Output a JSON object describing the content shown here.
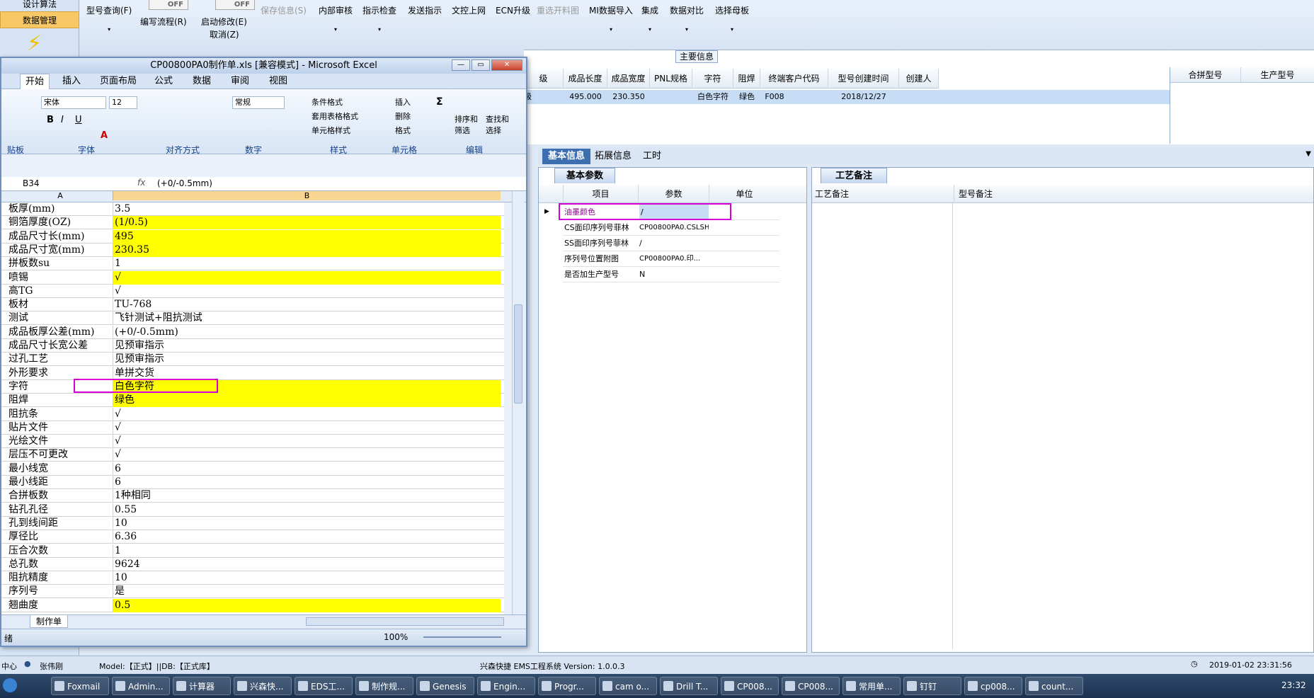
{
  "app": {
    "nav": [
      "设计算法",
      "数据管理"
    ],
    "toggles": [
      "OFF",
      "OFF"
    ],
    "ribbon": [
      "型号查询(F)",
      "编写流程(R)",
      "启动修改(E)",
      "取消(Z)",
      "保存信息(S)",
      "内部审核",
      "指示检查",
      "发送指示",
      "文控上网",
      "ECN升级",
      "重选开料图",
      "MI数据导入",
      "集成",
      "数据对比",
      "选择母板"
    ],
    "main_info_title": "主要信息",
    "grid_headers": [
      "级",
      "成品长度",
      "成品宽度",
      "PNL规格",
      "字符",
      "阻焊",
      "终端客户代码",
      "型号创建时间",
      "创建人"
    ],
    "grid_row": [
      "级",
      "495.000",
      "230.350",
      "",
      "白色字符",
      "绿色",
      "F008",
      "2018/12/27",
      ""
    ],
    "side_headers": [
      "合拼型号",
      "生产型号"
    ],
    "detail_tabs": [
      "基本信息",
      "拓展信息",
      "工时"
    ],
    "param_tab": "基本参数",
    "param_headers": [
      "项目",
      "参数",
      "单位"
    ],
    "param_rows": [
      {
        "item": "油墨颜色",
        "value": "/",
        "unit": ""
      },
      {
        "item": "CS面印序列号菲林",
        "value": "CP00800PA0.CSLSH",
        "unit": ""
      },
      {
        "item": "SS面印序列号菲林",
        "value": "/",
        "unit": ""
      },
      {
        "item": "序列号位置附图",
        "value": "CP00800PA0.印...",
        "unit": ""
      },
      {
        "item": "是否加生产型号",
        "value": "N",
        "unit": ""
      }
    ],
    "remark_tab": "工艺备注",
    "remark_headers": [
      "工艺备注",
      "型号备注"
    ],
    "status": {
      "center": "中心",
      "user": "张伟刚",
      "model": "Model:【正式】||DB:【正式库】",
      "system": "兴森快捷 EMS工程系统 Version: 1.0.0.3",
      "datetime": "2019-01-02 23:31:56"
    }
  },
  "excel": {
    "title": "CP00800PA0制作单.xls [兼容模式] - Microsoft Excel",
    "tabs": [
      "开始",
      "插入",
      "页面布局",
      "公式",
      "数据",
      "审阅",
      "视图"
    ],
    "font_name": "宋体",
    "font_size": "12",
    "number_format": "常规",
    "ribbon_small": [
      "条件格式",
      "套用表格格式",
      "单元格样式",
      "插入",
      "删除",
      "格式",
      "排序和",
      "筛选",
      "查找和",
      "选择"
    ],
    "groups": [
      "贴板",
      "字体",
      "对齐方式",
      "数字",
      "样式",
      "单元格",
      "编辑"
    ],
    "name_box": "B34",
    "fx": "fx",
    "formula": "(+0/-0.5mm)",
    "col_a": "A",
    "col_b": "B",
    "rows": [
      {
        "a": "板厚(mm)",
        "b": "3.5",
        "yellow": false
      },
      {
        "a": "铜箔厚度(OZ)",
        "b": "(1/0.5)",
        "yellow": true
      },
      {
        "a": "成品尺寸长(mm)",
        "b": "495",
        "yellow": true
      },
      {
        "a": "成品尺寸宽(mm)",
        "b": "230.35",
        "yellow": true
      },
      {
        "a": "拼板数su",
        "b": "1",
        "yellow": false
      },
      {
        "a": "喷锡",
        "b": "√",
        "yellow": true
      },
      {
        "a": "高TG",
        "b": "√",
        "yellow": false
      },
      {
        "a": "板材",
        "b": "TU-768",
        "yellow": false
      },
      {
        "a": "测试",
        "b": "飞针测试+阻抗测试",
        "yellow": false
      },
      {
        "a": "成品板厚公差(mm)",
        "b": "(+0/-0.5mm)",
        "yellow": false
      },
      {
        "a": "成品尺寸长宽公差",
        "b": "见预审指示",
        "yellow": false
      },
      {
        "a": "过孔工艺",
        "b": "见预审指示",
        "yellow": false
      },
      {
        "a": "外形要求",
        "b": "单拼交货",
        "yellow": false
      },
      {
        "a": "字符",
        "b": "白色字符",
        "yellow": true
      },
      {
        "a": "阻焊",
        "b": "绿色",
        "yellow": true
      },
      {
        "a": "阻抗条",
        "b": "√",
        "yellow": false
      },
      {
        "a": "贴片文件",
        "b": "√",
        "yellow": false
      },
      {
        "a": "光绘文件",
        "b": "√",
        "yellow": false
      },
      {
        "a": "层压不可更改",
        "b": "√",
        "yellow": false
      },
      {
        "a": "最小线宽",
        "b": "6",
        "yellow": false
      },
      {
        "a": "最小线距",
        "b": "6",
        "yellow": false
      },
      {
        "a": "合拼板数",
        "b": "1种相同",
        "yellow": false
      },
      {
        "a": "钻孔孔径",
        "b": "0.55",
        "yellow": false
      },
      {
        "a": "孔到线间距",
        "b": "10",
        "yellow": false
      },
      {
        "a": "厚径比",
        "b": "6.36",
        "yellow": false
      },
      {
        "a": "压合次数",
        "b": "1",
        "yellow": false
      },
      {
        "a": "总孔数",
        "b": "9624",
        "yellow": false
      },
      {
        "a": "阻抗精度",
        "b": "10",
        "yellow": false
      },
      {
        "a": "序列号",
        "b": "是",
        "yellow": false
      },
      {
        "a": "翘曲度",
        "b": "0.5",
        "yellow": true
      }
    ],
    "sheet_tab": "制作单",
    "status_left": "绪",
    "zoom": "100%"
  },
  "taskbar": {
    "items": [
      "Foxmail",
      "Admin...",
      "计算器",
      "兴森快...",
      "EDS工...",
      "制作规...",
      "Genesis",
      "Engin...",
      "Progr...",
      "cam o...",
      "Drill T...",
      "CP008...",
      "CP008...",
      "常用单...",
      "钉钉",
      "cp008...",
      "count..."
    ],
    "clock": "23:32"
  },
  "colors": {
    "highlight": "#d400d4",
    "yellow": "#ffff00",
    "selected_row": "#c7ddf5"
  }
}
